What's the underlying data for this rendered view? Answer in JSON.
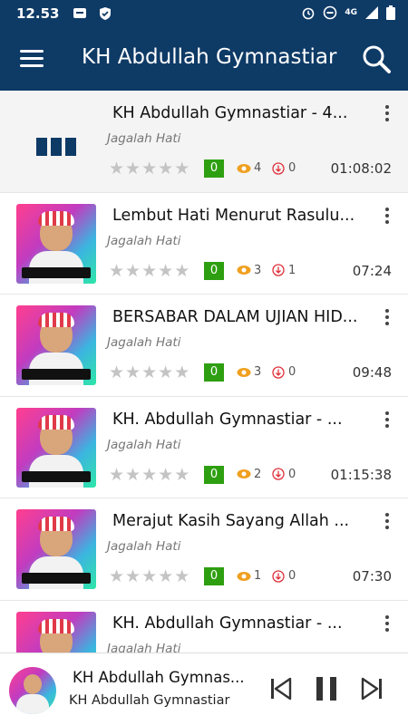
{
  "statusbar": {
    "time": "12.53",
    "network": "4G"
  },
  "header": {
    "title": "KH Abdullah Gymnastiar"
  },
  "list": {
    "items": [
      {
        "title": "KH Abdullah Gymnastiar - 4...",
        "artist": "Jagalah Hati",
        "rating": "0",
        "views": "4",
        "downloads": "0",
        "duration": "01:08:02",
        "state": "playing"
      },
      {
        "title": "Lembut Hati Menurut Rasulu...",
        "artist": "Jagalah Hati",
        "rating": "0",
        "views": "3",
        "downloads": "1",
        "duration": "07:24"
      },
      {
        "title": "BERSABAR DALAM UJIAN HID...",
        "artist": "Jagalah Hati",
        "rating": "0",
        "views": "3",
        "downloads": "0",
        "duration": "09:48"
      },
      {
        "title": "KH. Abdullah Gymnastiar - ...",
        "artist": "Jagalah Hati",
        "rating": "0",
        "views": "2",
        "downloads": "0",
        "duration": "01:15:38"
      },
      {
        "title": "Merajut Kasih Sayang Allah ...",
        "artist": "Jagalah Hati",
        "rating": "0",
        "views": "1",
        "downloads": "0",
        "duration": "07:30"
      },
      {
        "title": "KH. Abdullah Gymnastiar - ...",
        "artist": "Jagalah Hati",
        "rating": "",
        "views": "",
        "downloads": "",
        "duration": ""
      }
    ]
  },
  "player": {
    "title": "KH Abdullah Gymnas...",
    "artist": "KH Abdullah Gymnastiar"
  },
  "colors": {
    "primary": "#0e3a66",
    "rating_badge": "#2e9f10",
    "views_icon": "#f0a020",
    "download_icon": "#e0303a"
  }
}
